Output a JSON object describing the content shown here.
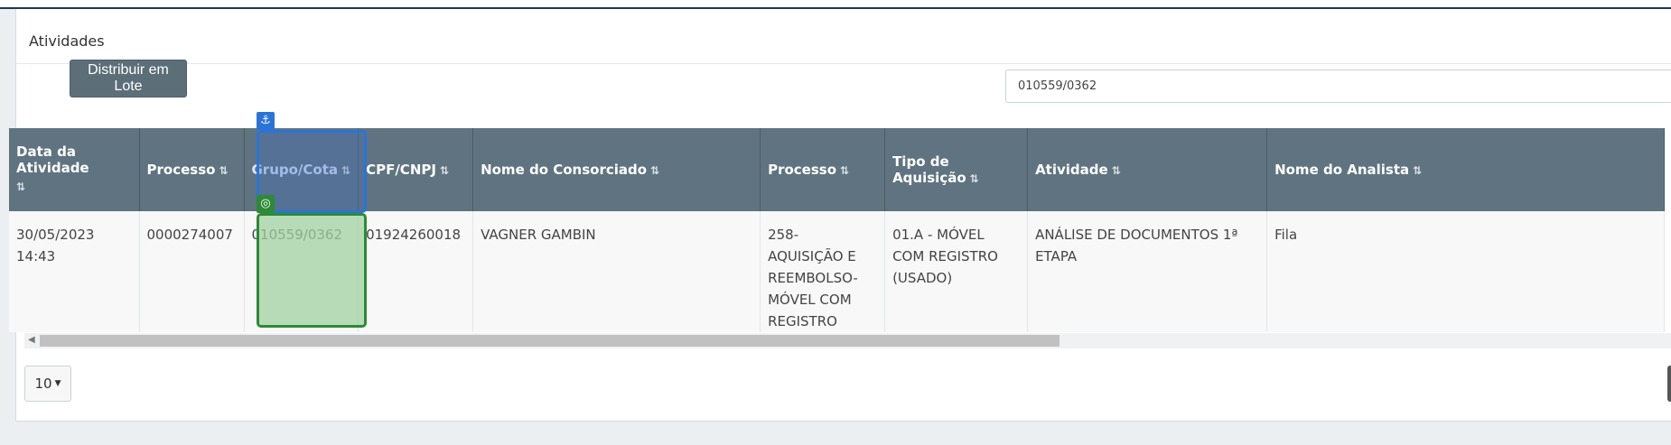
{
  "panel": {
    "title": "Atividades",
    "batch_button": "Distribuir em Lote",
    "search_value": "010559/0362",
    "page_size": "10"
  },
  "table": {
    "headers": [
      "Data da Atividade",
      "Processo",
      "Grupo/Cota",
      "CPF/CNPJ",
      "Nome do Consorciado",
      "Processo",
      "Tipo de Aquisição",
      "Atividade",
      "Nome do Analista"
    ],
    "rows": [
      [
        "30/05/2023 14:43",
        "0000274007",
        "010559/0362",
        "01924260018",
        "VAGNER GAMBIN",
        "258- AQUISIÇÃO E REEMBOLSO- MÓVEL COM REGISTRO",
        "01.A - MÓVEL COM REGISTRO (USADO)",
        "ANÁLISE DE DOCUMENTOS 1ª ETAPA",
        "Fila"
      ]
    ]
  },
  "icons": {
    "sort": "sort-icon",
    "anchor": "anchor-icon",
    "target": "target-icon",
    "caret": "caret-down-icon"
  },
  "colors": {
    "header_bg": "#5f7480",
    "button_bg": "#5c6e78",
    "selection_blue": "#2a74d8",
    "selection_green": "#2d8a36"
  }
}
